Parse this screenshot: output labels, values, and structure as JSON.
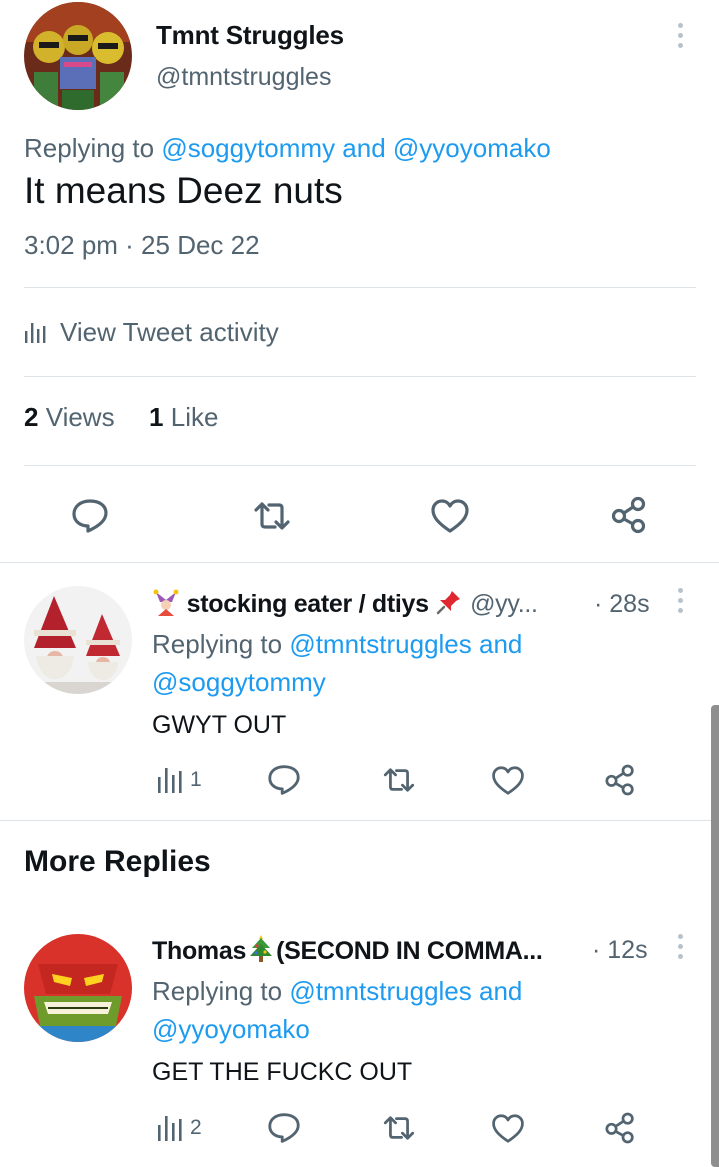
{
  "main_tweet": {
    "author_name": "Tmnt Struggles",
    "author_handle": "@tmntstruggles",
    "replying_prefix": "Replying to ",
    "replying_mentions": "@soggytommy and @yyoyomako",
    "text": "It means Deez nuts",
    "timestamp": "3:02 pm · 25 Dec 22",
    "activity_label": "View Tweet activity",
    "views_count": "2",
    "views_label": " Views",
    "likes_count": "1",
    "likes_label": " Like"
  },
  "reply_1": {
    "author_name": "stocking eater / dtiys",
    "author_handle": "@yy...",
    "time": "· 28s",
    "replying_prefix": "Replying to ",
    "replying_mentions_1": "@tmntstruggles and",
    "replying_mentions_2": "@soggytommy",
    "text": "GWYT OUT",
    "views_count": "1"
  },
  "more_replies": {
    "title": "More Replies"
  },
  "reply_2": {
    "author_name": "Thomas",
    "author_name_rest": "(SECOND IN COMMA...",
    "time": "· 12s",
    "replying_prefix": "Replying to ",
    "replying_mentions_1": "@tmntstruggles and",
    "replying_mentions_2": "@yyoyomako",
    "text": "GET THE FUCKC OUT",
    "views_count": "2"
  },
  "colors": {
    "link": "#1d9bf0",
    "secondary_text": "#536471",
    "primary_text": "#0f1419",
    "divider": "#dde3e7"
  },
  "icons": [
    "more-icon",
    "analytics-icon",
    "reply-icon",
    "retweet-icon",
    "like-icon",
    "share-icon",
    "jester-emoji",
    "pushpin-emoji",
    "christmas-tree-emoji"
  ]
}
